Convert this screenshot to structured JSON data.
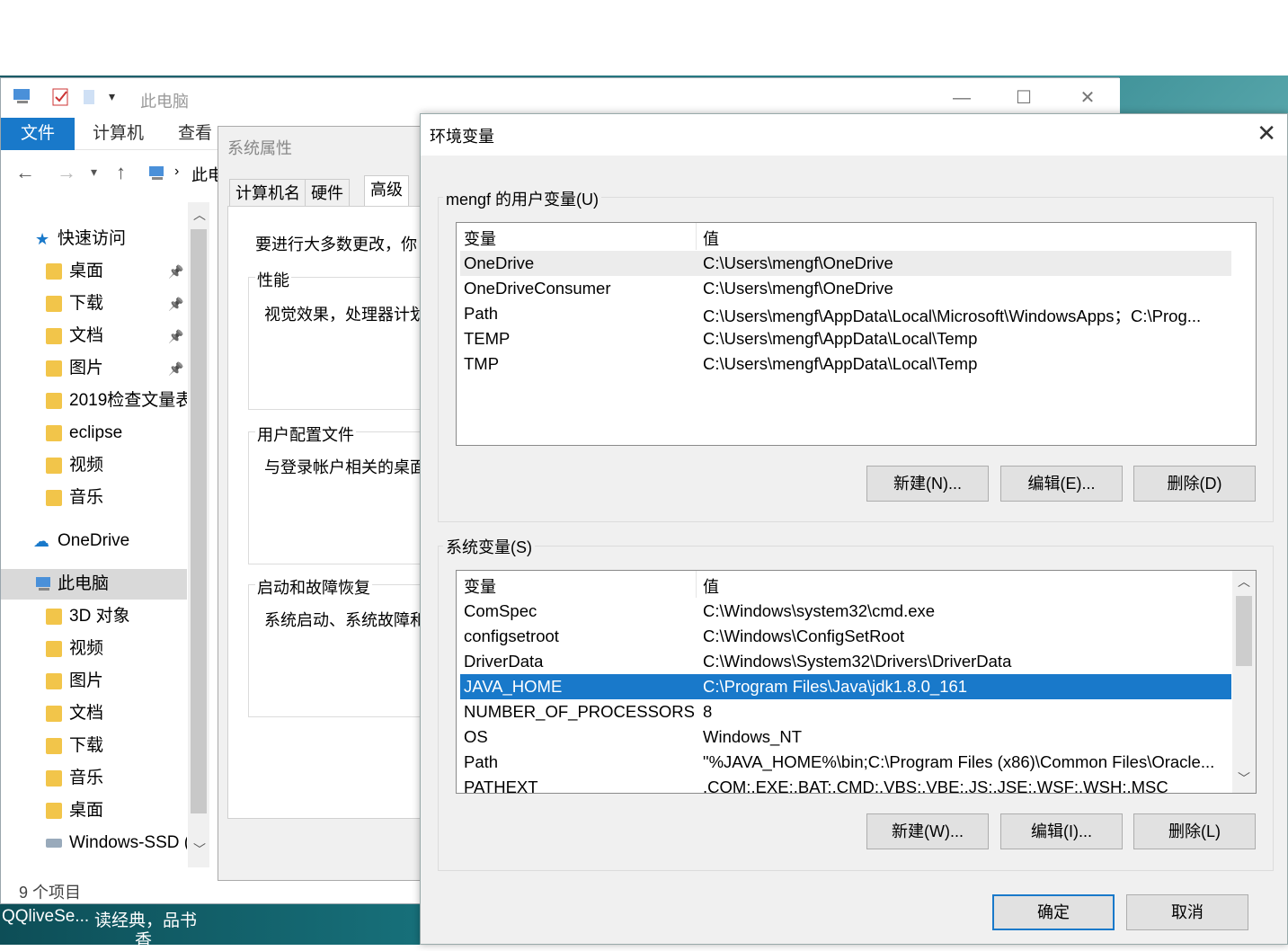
{
  "explorer": {
    "title": "此电脑",
    "ribbon_tabs": [
      "文件",
      "计算机",
      "查看"
    ],
    "address": "此电",
    "nav": {
      "quick_access": "快速访问",
      "items": [
        {
          "label": "桌面",
          "pinned": true
        },
        {
          "label": "下载",
          "pinned": true
        },
        {
          "label": "文档",
          "pinned": true
        },
        {
          "label": "图片",
          "pinned": true
        },
        {
          "label": "2019检查文量表",
          "pinned": false
        },
        {
          "label": "eclipse",
          "pinned": false
        },
        {
          "label": "视频",
          "pinned": false
        },
        {
          "label": "音乐",
          "pinned": false
        }
      ],
      "onedrive": "OneDrive",
      "this_pc": "此电脑",
      "pc_items": [
        "3D 对象",
        "视频",
        "图片",
        "文档",
        "下载",
        "音乐",
        "桌面",
        "Windows-SSD ("
      ]
    },
    "status": "9 个项目"
  },
  "taskbar": {
    "left": "QQliveSe...",
    "right": "读经典，品书",
    "right2": "香"
  },
  "sysprop": {
    "title": "系统属性",
    "tabs": [
      "计算机名",
      "硬件",
      "高级"
    ],
    "intro": "要进行大多数更改，你",
    "perf_label": "性能",
    "perf_text": "视觉效果，处理器计划",
    "profile_label": "用户配置文件",
    "profile_text": "与登录帐户相关的桌面",
    "startup_label": "启动和故障恢复",
    "startup_text": "系统启动、系统故障和"
  },
  "env": {
    "title": "环境变量",
    "user_label": "mengf 的用户变量(U)",
    "col_var": "变量",
    "col_val": "值",
    "user_vars": [
      {
        "name": "OneDrive",
        "value": "C:\\Users\\mengf\\OneDrive"
      },
      {
        "name": "OneDriveConsumer",
        "value": "C:\\Users\\mengf\\OneDrive"
      },
      {
        "name": "Path",
        "value": "C:\\Users\\mengf\\AppData\\Local\\Microsoft\\WindowsApps；C:\\Prog..."
      },
      {
        "name": "TEMP",
        "value": "C:\\Users\\mengf\\AppData\\Local\\Temp"
      },
      {
        "name": "TMP",
        "value": "C:\\Users\\mengf\\AppData\\Local\\Temp"
      }
    ],
    "user_buttons": [
      "新建(N)...",
      "编辑(E)...",
      "删除(D)"
    ],
    "sys_label": "系统变量(S)",
    "sys_vars": [
      {
        "name": "ComSpec",
        "value": "C:\\Windows\\system32\\cmd.exe"
      },
      {
        "name": "configsetroot",
        "value": "C:\\Windows\\ConfigSetRoot"
      },
      {
        "name": "DriverData",
        "value": "C:\\Windows\\System32\\Drivers\\DriverData"
      },
      {
        "name": "JAVA_HOME",
        "value": "C:\\Program Files\\Java\\jdk1.8.0_161"
      },
      {
        "name": "NUMBER_OF_PROCESSORS",
        "value": "8"
      },
      {
        "name": "OS",
        "value": "Windows_NT"
      },
      {
        "name": "Path",
        "value": "\"%JAVA_HOME%\\bin;C:\\Program Files (x86)\\Common Files\\Oracle..."
      },
      {
        "name": "PATHEXT",
        "value": ".COM;.EXE;.BAT;.CMD;.VBS;.VBE;.JS;.JSE;.WSF;.WSH;.MSC"
      }
    ],
    "sys_buttons": [
      "新建(W)...",
      "编辑(I)...",
      "删除(L)"
    ],
    "ok": "确定",
    "cancel": "取消",
    "colors": {
      "selection": "#1979ca"
    }
  }
}
